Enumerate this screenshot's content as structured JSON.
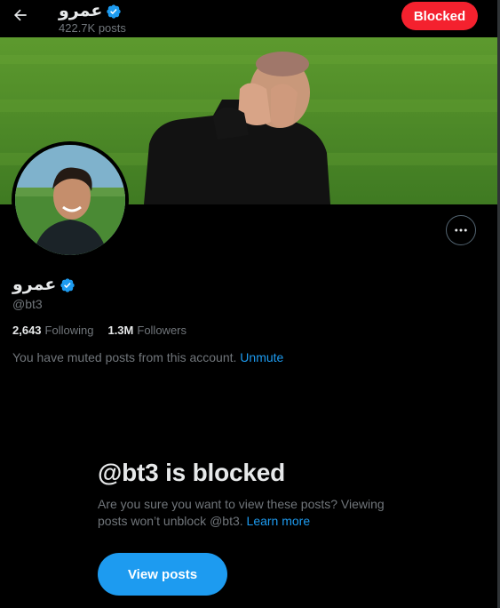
{
  "header": {
    "name": "عمرو",
    "posts_count": "422.7K posts",
    "blocked_label": "Blocked"
  },
  "profile": {
    "name": "عمرو",
    "handle": "@bt3",
    "following_count": "2,643",
    "following_label": "Following",
    "followers_count": "1.3M",
    "followers_label": "Followers",
    "muted_text": "You have muted posts from this account.",
    "unmute_label": "Unmute"
  },
  "blocked_panel": {
    "title": "@bt3 is blocked",
    "description": "Are you sure you want to view these posts? Viewing posts won’t unblock @bt3.",
    "learn_more_label": "Learn more",
    "view_posts_label": "View posts"
  },
  "icons": {
    "back": "arrow-left-icon",
    "verified": "verified-badge-icon",
    "more": "more-horizontal-icon"
  },
  "colors": {
    "background": "#000000",
    "blocked_red": "#f4212e",
    "accent_blue": "#1d9bf0",
    "muted_text": "#71767b",
    "primary_text": "#e7e9ea"
  }
}
